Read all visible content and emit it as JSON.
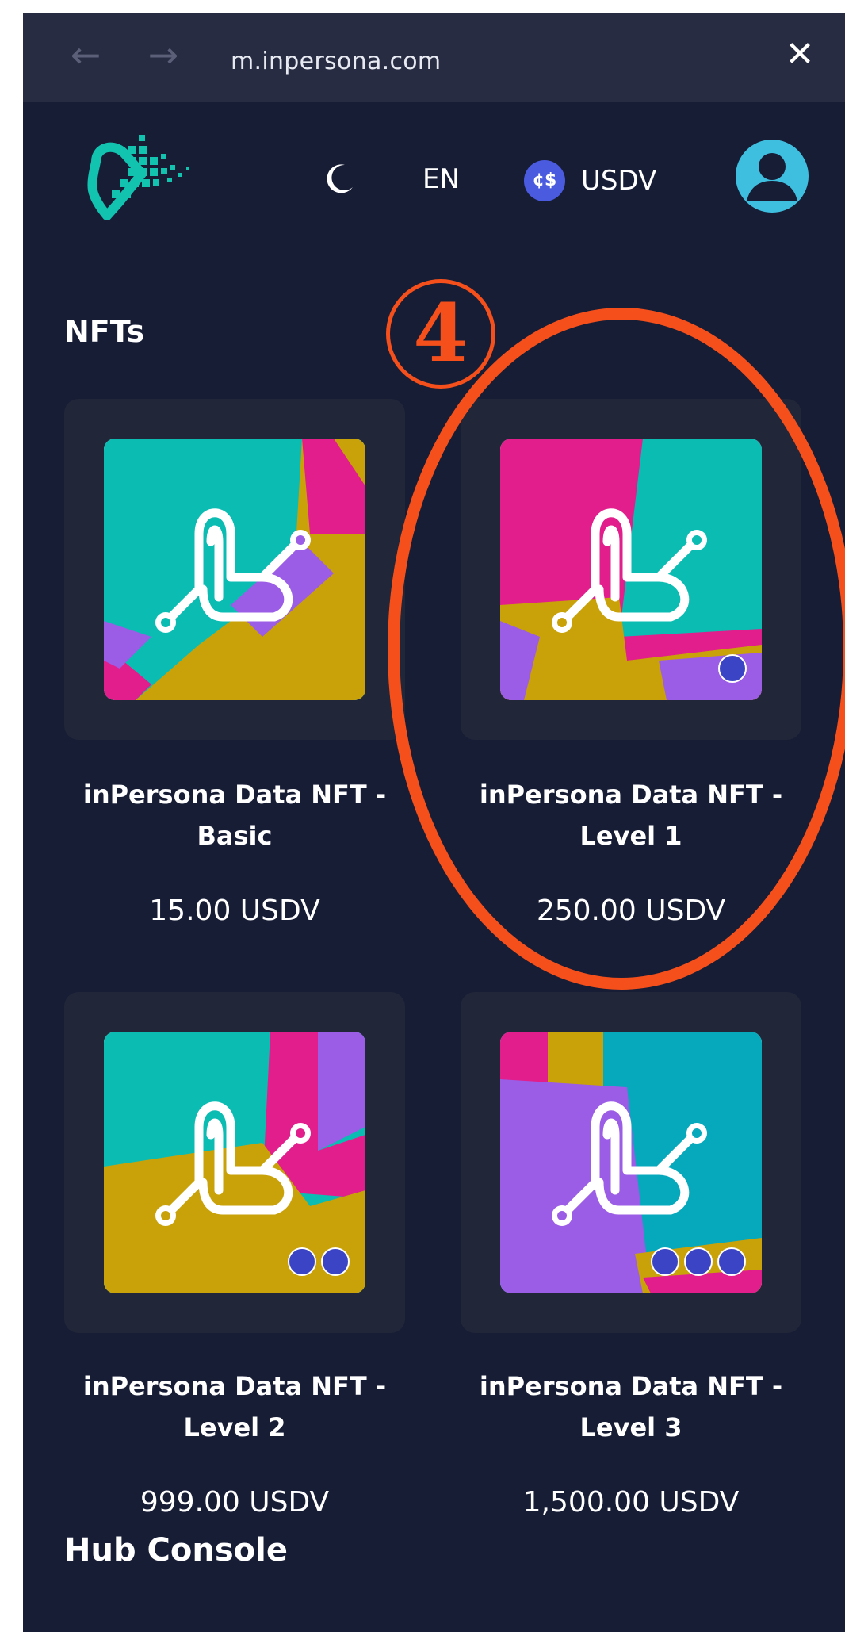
{
  "browser": {
    "url": "m.inpersona.com"
  },
  "header": {
    "language": "EN",
    "currency": "USDV"
  },
  "section": {
    "title": "NFTs"
  },
  "nfts": [
    {
      "title_line1": "inPersona Data NFT -",
      "title_line2": "Basic",
      "price": "15.00 USDV"
    },
    {
      "title_line1": "inPersona Data NFT -",
      "title_line2": "Level 1",
      "price": "250.00 USDV"
    },
    {
      "title_line1": "inPersona Data NFT -",
      "title_line2": "Level 2",
      "price": "999.00 USDV"
    },
    {
      "title_line1": "inPersona Data NFT -",
      "title_line2": "Level 3",
      "price": "1,500.00 USDV"
    }
  ],
  "footer_section": {
    "title": "Hub Console"
  },
  "annotation": {
    "number": "4"
  },
  "colors": {
    "background": "#181d36",
    "card": "#212639",
    "annotation": "#f5501b",
    "teal": "#0bbcb3",
    "magenta": "#e11e8c",
    "gold": "#c9a20a",
    "purple": "#9b5ce6"
  },
  "icons": [
    "back-arrow-icon",
    "forward-arrow-icon",
    "close-icon",
    "moon-icon",
    "coin-icon",
    "user-icon",
    "badge-icon"
  ]
}
